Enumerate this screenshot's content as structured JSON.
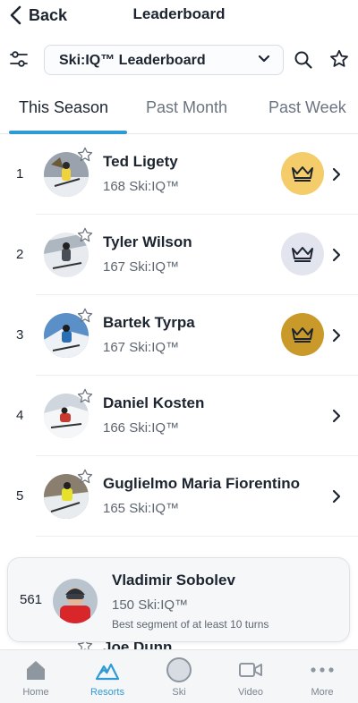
{
  "header": {
    "back_label": "Back",
    "title": "Leaderboard"
  },
  "filter": {
    "selected": "Ski:IQ™ Leaderboard"
  },
  "tabs": [
    {
      "label": "This Season",
      "active": true
    },
    {
      "label": "Past Month",
      "active": false
    },
    {
      "label": "Past Week",
      "active": false
    }
  ],
  "leaderboard": [
    {
      "rank": "1",
      "name": "Ted Ligety",
      "score": "168 Ski:IQ™",
      "medal": "gold"
    },
    {
      "rank": "2",
      "name": "Tyler Wilson",
      "score": "167 Ski:IQ™",
      "medal": "silver"
    },
    {
      "rank": "3",
      "name": "Bartek Tyrpa",
      "score": "167 Ski:IQ™",
      "medal": "bronze"
    },
    {
      "rank": "4",
      "name": "Daniel Kosten",
      "score": "166 Ski:IQ™",
      "medal": "none"
    },
    {
      "rank": "5",
      "name": "Guglielmo Maria Fiorentino",
      "score": "165 Ski:IQ™",
      "medal": "none"
    }
  ],
  "my_entry": {
    "rank": "561",
    "name": "Vladimir Sobolev",
    "score": "150 Ski:IQ™",
    "note": "Best segment of at least 10 turns"
  },
  "peek_row": {
    "name": "Joe Dunn"
  },
  "nav": [
    {
      "label": "Home",
      "icon": "home-icon",
      "active": false
    },
    {
      "label": "Resorts",
      "icon": "mountain-icon",
      "active": true
    },
    {
      "label": "Ski",
      "icon": "ski-circle-icon",
      "active": false
    },
    {
      "label": "Video",
      "icon": "video-icon",
      "active": false
    },
    {
      "label": "More",
      "icon": "more-dots-icon",
      "active": false
    }
  ],
  "colors": {
    "accent": "#2e9bd6",
    "gold": "#f4cc6a",
    "silver": "#e3e5ee",
    "bronze": "#c99a2a"
  }
}
